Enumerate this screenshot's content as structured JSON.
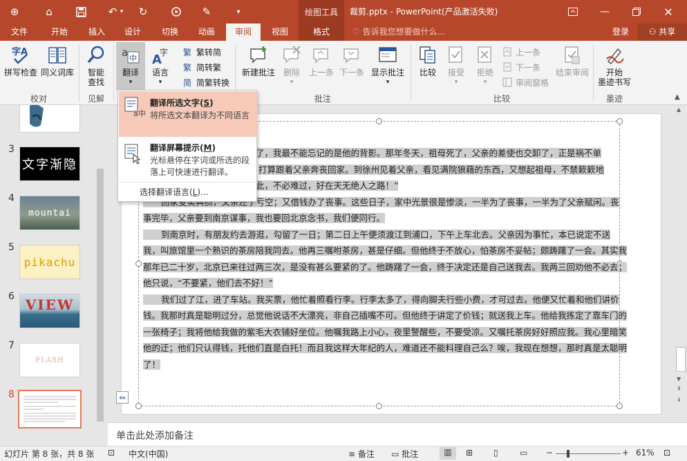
{
  "titlebar": {
    "context_tools": "绘图工具",
    "document_title": "裁剪.pptx - PowerPoint(产品激活失败)",
    "qa_icons": [
      "touch-mode-icon",
      "pin-icon",
      "save-icon",
      "undo-icon",
      "redo-icon",
      "slideshow-icon",
      "format-painter-icon",
      "customize-icon"
    ]
  },
  "tabs": [
    {
      "label": "文件"
    },
    {
      "label": "开始"
    },
    {
      "label": "插入"
    },
    {
      "label": "设计"
    },
    {
      "label": "切换"
    },
    {
      "label": "动画"
    },
    {
      "label": "审阅"
    },
    {
      "label": "视图"
    },
    {
      "label": "格式"
    }
  ],
  "tellme": {
    "placeholder": "告诉我您想要做什么..."
  },
  "account": {
    "login": "登录",
    "share": "共享"
  },
  "ribbon": {
    "proofing": {
      "spellcheck": "拼写检查",
      "thesaurus": "同义词库",
      "group": "校对"
    },
    "insights": {
      "smart_lookup_1": "智能",
      "smart_lookup_2": "查找",
      "group": "见解"
    },
    "language": {
      "translate": "翻译",
      "language": "语言",
      "to_trad": "繁转简",
      "to_simp": "简转繁",
      "convert": "简繁转换",
      "group": "语言"
    },
    "comments": {
      "new": "新建批注",
      "delete": "删除",
      "prev": "上一条",
      "next": "下一条",
      "show": "显示批注",
      "group": "批注"
    },
    "compare": {
      "compare": "比较",
      "accept": "接受",
      "reject": "拒绝",
      "prev": "上一条",
      "next": "下一条",
      "pane": "审阅窗格",
      "end": "结束审阅",
      "group": "比较"
    },
    "ink": {
      "start_1": "开始",
      "start_2": "墨迹书写",
      "group": "墨迹"
    }
  },
  "translate_menu": {
    "item1_title": "翻译所选文字(",
    "item1_key": "S",
    "item1_desc": "将所选文本翻译为不同语言",
    "item2_title": "翻译屏幕提示(",
    "item2_key": "M",
    "item2_desc": "光标悬停在字词或所选的段落上可快速进行翻译。",
    "item3_prefix": "选择翻译语言(",
    "item3_key": "L",
    "item3_suffix": ")..."
  },
  "thumbnails": [
    {
      "num": "3",
      "text": "文字渐隐"
    },
    {
      "num": "4",
      "text": "mountai"
    },
    {
      "num": "5",
      "text": "pikachu"
    },
    {
      "num": "6",
      "text": "VIEW"
    },
    {
      "num": "7",
      "text": "FLASH"
    },
    {
      "num": "8",
      "text": ""
    }
  ],
  "slide": {
    "line1": "了，我最不能忘记的是他的背影。那年冬天，祖母死了，父亲的差使也交卸了，正是祸不单",
    "line2": "打算跟着父亲奔丧回家。到徐州见着父亲，看见满院狼藉的东西，又想起祖母，不禁簌簌地",
    "line3": "此，不必难过，好在天无绝人之路！”",
    "p2a": "回家变卖典质，父亲还了亏空；又借钱办了丧事。这些日子，家中光景很是惨淡，一半为了丧事，一半为了父亲赋闲。",
    "p2b": "丧事完毕，父亲要到南京谋事，我也要回北京念书，我们便同行。",
    "p3": "到南京时，有朋友约去游逛，勾留了一日；第二日上午便须渡江到浦口，下午上车北去。父亲因为事忙，本已说定不送我，叫旅馆里一个熟识的茶房陪我同去。他再三嘱咐茶房，甚是仔细。但他终于不放心，怕茶房不妥帖；颇踌躇了一会。其实我那年已二十岁，北京已来往过两三次，是没有甚么要紧的了。他踌躇了一会，终于决定还是自己送我去。我两三回劝他不必去；他只说，“不要紧，他们去不好！”",
    "p4": "我们过了江，进了车站。我买票，他忙着照看行李。行李太多了，得向脚夫行些小费，才可过去。他便又忙着和他们讲价钱。我那时真是聪明过分，总觉他说话不大漂亮，非自己插嘴不可。但他终于讲定了价钱；就送我上车。他给我拣定了靠车门的一张椅子；我将他给我做的紫毛大衣铺好坐位。他嘱我路上小心，夜里警醒些，不要受凉。又嘱托茶房好好照应我。我心里暗笑他的迂；他们只认得钱，托他们直是白托！而且我这样大年纪的人，难道还不能料理自己么？唉，我现在想想，那时真是太聪明了！"
  },
  "notes": {
    "placeholder": "单击此处添加备注"
  },
  "status": {
    "slide_info": "幻灯片 第 8 张，共 8 张",
    "language": "中文(中国)",
    "notes": "备注",
    "comments": "批注",
    "zoom": "61%"
  },
  "colors": {
    "accent": "#b7472a",
    "hover": "#f6c9b9",
    "selected_thumb": "#e07a56"
  }
}
